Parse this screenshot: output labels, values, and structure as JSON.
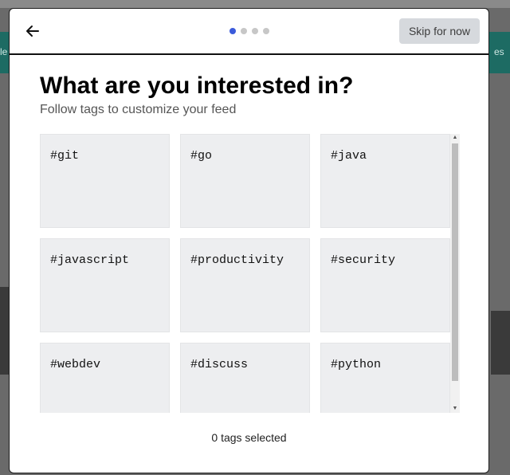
{
  "background": {
    "left_fragment": "le",
    "right_fragment": "es"
  },
  "header": {
    "back_icon": "arrow-left-icon",
    "steps": {
      "total": 4,
      "current": 1
    },
    "skip_label": "Skip for now"
  },
  "main": {
    "title": "What are you interested in?",
    "subtitle": "Follow tags to customize your feed",
    "tags": [
      "#git",
      "#go",
      "#java",
      "#javascript",
      "#productivity",
      "#security",
      "#webdev",
      "#discuss",
      "#python"
    ]
  },
  "footer": {
    "selected_text": "0 tags selected"
  },
  "colors": {
    "active_dot": "#3b5bdb",
    "card_bg": "#edeef0",
    "skip_bg": "#d6d9dd"
  }
}
